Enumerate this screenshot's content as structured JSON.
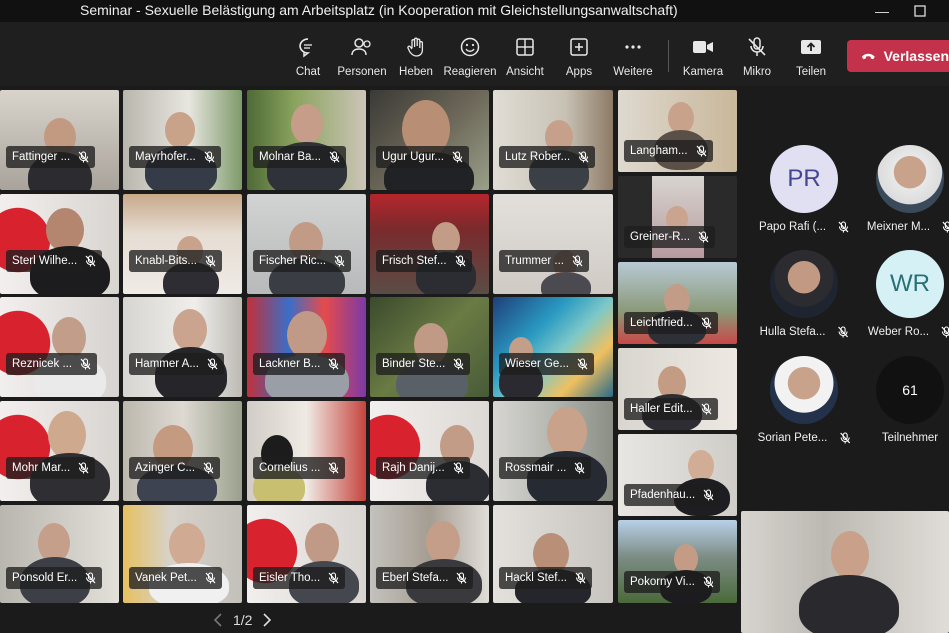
{
  "window": {
    "title": "Seminar - Sexuelle Belästigung am Arbeitsplatz (in Kooperation mit Gleichstellungsanwaltschaft)"
  },
  "toolbar": {
    "chat": "Chat",
    "persons": "Personen",
    "raise": "Heben",
    "react": "Reagieren",
    "view": "Ansicht",
    "apps": "Apps",
    "more": "Weitere",
    "camera": "Kamera",
    "mic": "Mikro",
    "share": "Teilen",
    "leave": "Verlassen"
  },
  "grid": [
    "Fattinger ...",
    "Mayrhofer...",
    "Molnar Ba...",
    "Ugur Ugur...",
    "Lutz Rober...",
    "Sterl Wilhe...",
    "Knabl-Bits...",
    "Fischer Ric...",
    "Frisch Stef...",
    "Trummer ...",
    "Reznicek ...",
    "Hammer A...",
    "Lackner B...",
    "Binder Ste...",
    "Wieser Ge...",
    "Mohr Mar...",
    "Azinger C...",
    "Cornelius ...",
    "Rajh Danij...",
    "Rossmair ...",
    "Ponsold Er...",
    "Vanek Pet...",
    "Eisler Tho...",
    "Eberl Stefa...",
    "Hackl Stef..."
  ],
  "column6": [
    "Langham...",
    "Greiner-R...",
    "Leichtfried...",
    "Haller Edit...",
    "Pfadenhau...",
    "Pokorny Vi..."
  ],
  "side": {
    "p1": {
      "initials": "PR",
      "name": "Papo Rafi (..."
    },
    "p2": {
      "name": "Meixner M..."
    },
    "p3": {
      "name": "Hulla Stefa..."
    },
    "p4": {
      "initials": "WR",
      "name": "Weber Ro..."
    },
    "p5": {
      "name": "Sorian Pete..."
    },
    "more": {
      "count": "61",
      "label": "Teilnehmer"
    }
  },
  "pager": {
    "label": "1/2"
  },
  "colors": {
    "leave": "#c4314b",
    "pr_avatar": "#e1dff2",
    "wr_avatar": "#d6f1f5"
  }
}
